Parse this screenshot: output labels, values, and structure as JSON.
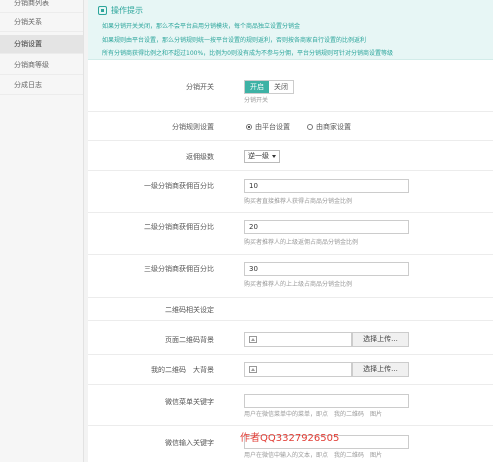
{
  "sidebar": {
    "items": [
      {
        "label": "分销商列表",
        "active": false
      },
      {
        "label": "分销关系",
        "active": false
      },
      {
        "label": "分销设置",
        "active": true
      },
      {
        "label": "分销商等级",
        "active": false
      },
      {
        "label": "分成日志",
        "active": false
      }
    ]
  },
  "tips": {
    "title": "操作提示",
    "lines": [
      "如果分销开关关闭，那么不会平台启用分销模块，每个商品独立设置分销金",
      "如果规则由平台设置，那么分销规则统一按平台设置的规则返利，否则按各商家自行设置的比例返利",
      "所有分销商获得比例之和不超过100%，比例为0则没有成为不参与分佣，平台分销规则可针对分销商设置等级"
    ]
  },
  "form": {
    "switch": {
      "label": "分销开关",
      "on_label": "开启",
      "off_label": "关闭",
      "hint": "分销开关"
    },
    "rule": {
      "label": "分销规则设置",
      "option_platform": "由平台设置",
      "option_merchant": "由商家设置",
      "selected": "platform"
    },
    "levels": {
      "label": "返佣级数",
      "value": "逆一级"
    },
    "level1": {
      "label": "一级分销商获佣百分比",
      "value": "10",
      "hint": "购买者直接推荐人获得占商品分销金比例"
    },
    "level2": {
      "label": "二级分销商获佣百分比",
      "value": "20",
      "hint": "购买者推荐人的上级返佣占商品分销金比例"
    },
    "level3": {
      "label": "三级分销商获佣百分比",
      "value": "30",
      "hint": "购买者推荐人的上上级占商品分销金比例"
    },
    "qrcode_section": {
      "label": "二维码相关设定"
    },
    "page_bg": {
      "label": "页面二维码背景",
      "button": "选择上传..."
    },
    "my_qrcode": {
      "label": "我的二维码　大背景",
      "button": "选择上传..."
    },
    "wechat_menu": {
      "label": "微信菜单关键字",
      "hint": "用户在微信菜单中的菜单，即点　我的二维码　图片"
    },
    "wechat_input": {
      "label": "微信输入关键字",
      "hint": "用户在微信中输入的文本，即点　我的二维码　图片"
    }
  },
  "watermark": "作者QQ3327926505",
  "colors": {
    "accent": "#3db2a5",
    "tips_bg": "#e7f6f5",
    "watermark": "#e23d35"
  }
}
